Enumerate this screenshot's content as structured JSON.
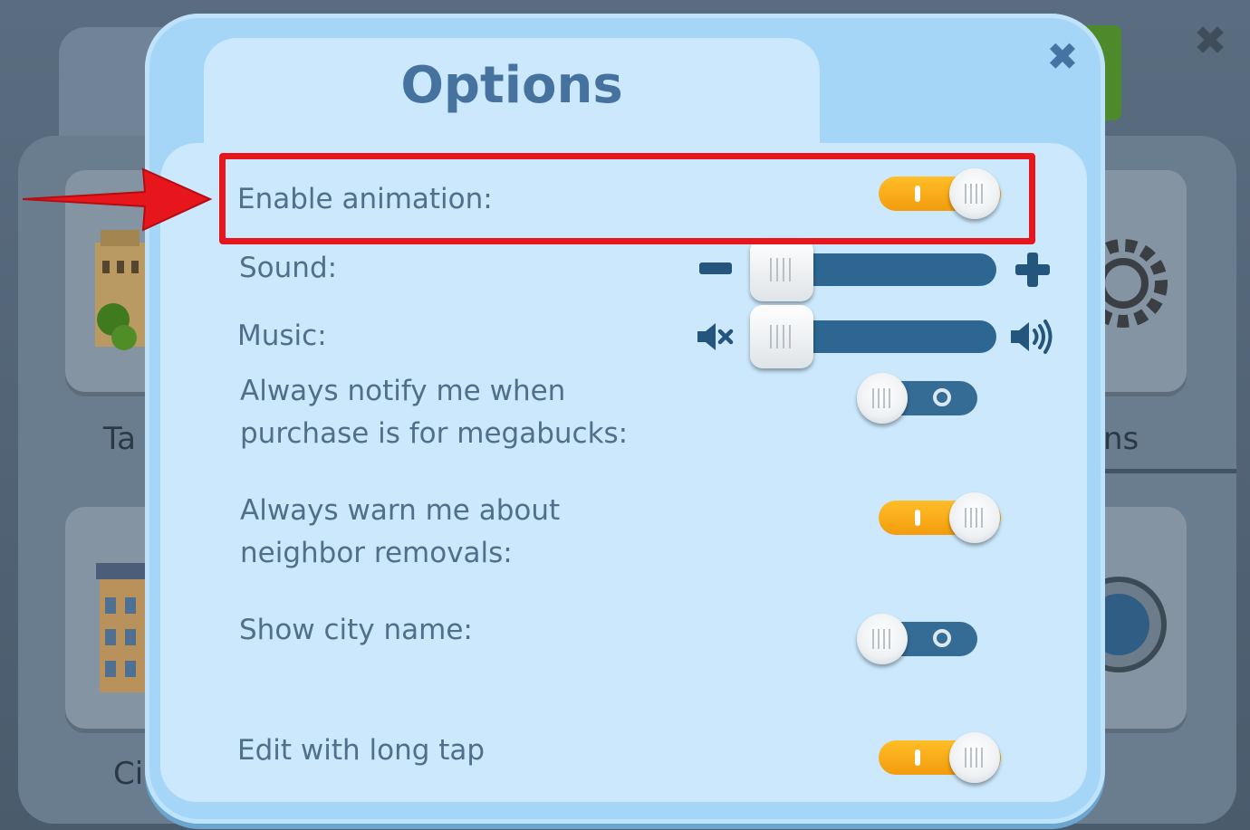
{
  "background": {
    "tile_labels": [
      "Ta",
      "ns",
      "Ci"
    ]
  },
  "dialog": {
    "title": "Options",
    "close_icon": "close-x-icon"
  },
  "options": {
    "enable_animation": {
      "label": "Enable animation:",
      "state": "on"
    },
    "sound": {
      "label": "Sound:",
      "level": 0,
      "minus_icon": "minus-icon",
      "plus_icon": "plus-icon"
    },
    "music": {
      "label": "Music:",
      "level": 0,
      "mute_icon": "speaker-mute-icon",
      "loud_icon": "speaker-loud-icon"
    },
    "notify_megabucks": {
      "label_line1": "Always notify me when",
      "label_line2": "purchase is for megabucks:",
      "state": "off"
    },
    "warn_neighbor": {
      "label_line1": "Always warn me about",
      "label_line2": "neighbor removals:",
      "state": "on"
    },
    "show_city_name": {
      "label": "Show city name:",
      "state": "off"
    },
    "edit_long_tap": {
      "label": "Edit with long tap",
      "state": "on"
    }
  },
  "colors": {
    "dialog_bg": "#a6d6f7",
    "content_bg": "#cbe8fc",
    "title_text": "#46729f",
    "toggle_on": "#f7a816",
    "toggle_off": "#356c96",
    "highlight": "#e6161c"
  }
}
